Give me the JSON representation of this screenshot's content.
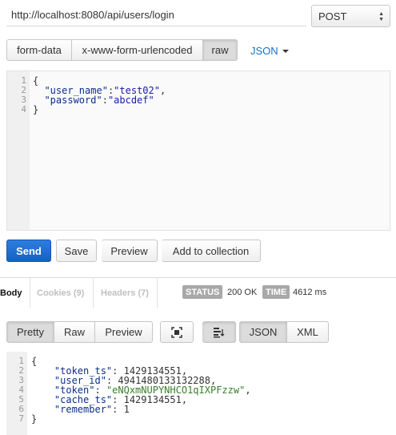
{
  "request": {
    "url": "http://localhost:8080/api/users/login",
    "method": "POST",
    "body_tabs": [
      "form-data",
      "x-www-form-urlencoded",
      "raw"
    ],
    "active_body_tab": "raw",
    "format": "JSON",
    "body_lines": [
      "1",
      "2",
      "3",
      "4"
    ]
  },
  "request_body": {
    "open": "{",
    "k1": "\"user_name\"",
    "v1": "\"test02\"",
    "k2": "\"password\"",
    "v2": "\"abcdef\"",
    "close": "}"
  },
  "actions": {
    "send": "Send",
    "save": "Save",
    "preview": "Preview",
    "add_to_collection": "Add to collection"
  },
  "response_tabs": {
    "body": "Body",
    "cookies": "Cookies (9)",
    "headers": "Headers (7)"
  },
  "status": {
    "status_label": "STATUS",
    "status_value": "200 OK",
    "time_label": "TIME",
    "time_value": "4612 ms"
  },
  "view_modes": {
    "pretty": "Pretty",
    "raw": "Raw",
    "preview": "Preview",
    "json": "JSON",
    "xml": "XML"
  },
  "icons": [
    "fullscreen-icon",
    "wrap-lines-icon",
    "select-arrows-icon",
    "caret-down-icon"
  ],
  "response_body": {
    "open": "{",
    "k1": "\"token_ts\"",
    "v1": "1429134551",
    "k2": "\"user_id\"",
    "v2": "4941480133132288",
    "k3": "\"token\"",
    "v3": "\"eNQxmNUPYNHCO1qIXPFzzw\"",
    "k4": "\"cache_ts\"",
    "v4": "1429134551",
    "k5": "\"remember\"",
    "v5": "1",
    "close": "}"
  },
  "response_lines": [
    "1",
    "2",
    "3",
    "4",
    "5",
    "6",
    "7"
  ],
  "colors": {
    "send_button": "#1660c4",
    "link_blue": "#1a6fc4",
    "badge_gray": "#a8a8a8",
    "json_key": "#0b2e8a",
    "json_string": "#3a7d2c"
  }
}
